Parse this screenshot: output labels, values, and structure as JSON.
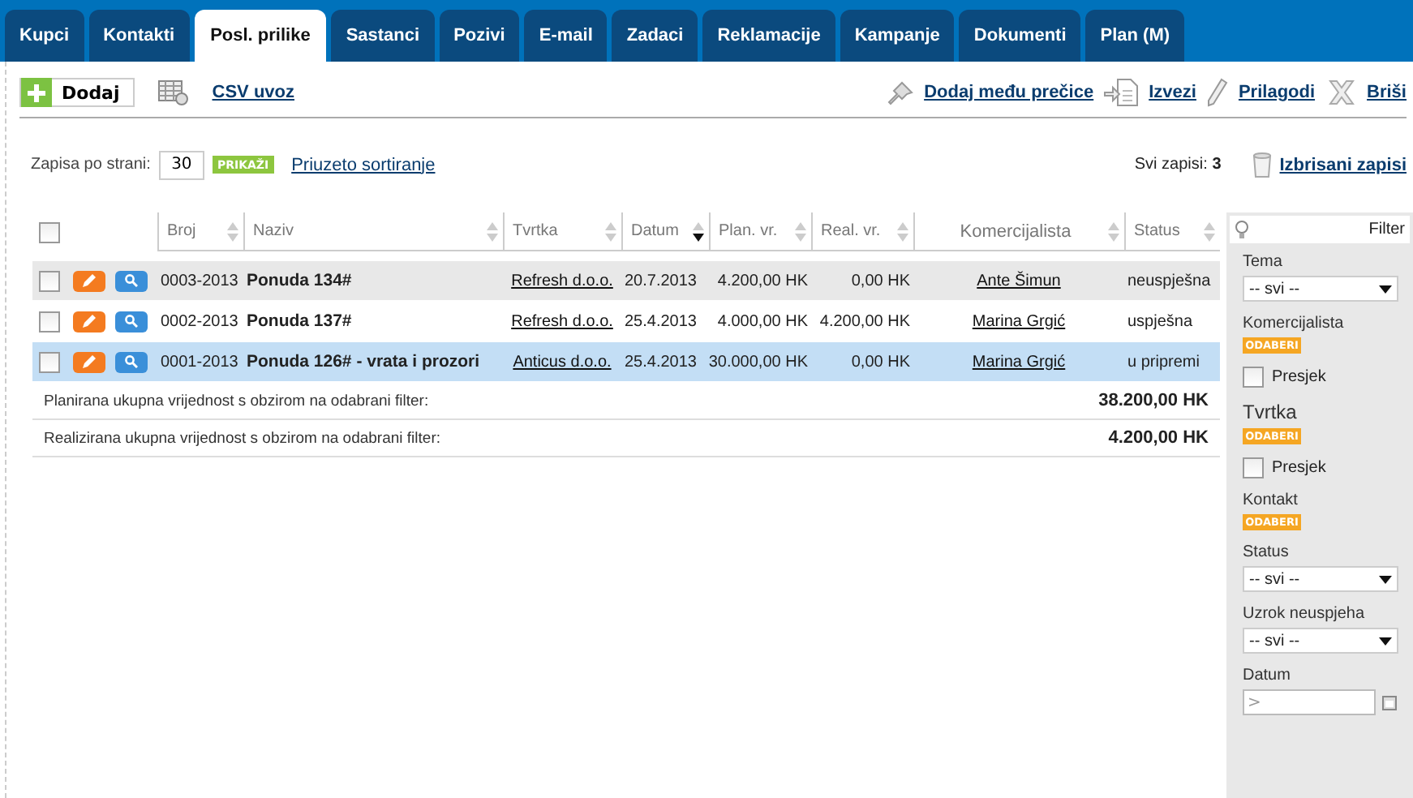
{
  "tabs": [
    {
      "label": "Kupci",
      "selected": false
    },
    {
      "label": "Kontakti",
      "selected": false
    },
    {
      "label": "Posl. prilike",
      "selected": true
    },
    {
      "label": "Sastanci",
      "selected": false
    },
    {
      "label": "Pozivi",
      "selected": false
    },
    {
      "label": "E-mail",
      "selected": false
    },
    {
      "label": "Zadaci",
      "selected": false
    },
    {
      "label": "Reklamacije",
      "selected": false
    },
    {
      "label": "Kampanje",
      "selected": false
    },
    {
      "label": "Dokumenti",
      "selected": false
    },
    {
      "label": "Plan (M)",
      "selected": false
    }
  ],
  "toolbar": {
    "add_button": "Dodaj",
    "csv_link": "CSV uvoz",
    "actions": [
      {
        "kind": "pin",
        "label": "Dodaj među prečice"
      },
      {
        "kind": "export",
        "label": "Izvezi"
      },
      {
        "kind": "pencil",
        "label": "Prilagodi"
      },
      {
        "kind": "cross",
        "label": "Briši"
      }
    ]
  },
  "paging": {
    "label": "Zapisa po strani:",
    "value": "30",
    "show_button": "PRIKAŽI",
    "sort_link": "Priuzeto sortiranje",
    "total_label": "Svi zapisi:",
    "total_count": "3",
    "deleted_link": "Izbrisani zapisi"
  },
  "table": {
    "select_all_checked": false,
    "columns": [
      {
        "label": "Broj",
        "sorted": false
      },
      {
        "label": "Naziv",
        "sorted": false
      },
      {
        "label": "Tvrtka",
        "sorted": false
      },
      {
        "label": "Datum",
        "sorted": true
      },
      {
        "label": "Plan. vr.",
        "sorted": false
      },
      {
        "label": "Real. vr.",
        "sorted": false
      },
      {
        "label": "Komercijalista",
        "sorted": false
      },
      {
        "label": "Status",
        "sorted": false
      }
    ],
    "rows": [
      {
        "checked": false,
        "selected": false,
        "hovered": true,
        "broj": "0003-2013",
        "naziv": "Ponuda 134#",
        "tvrtka": "Refresh d.o.o.",
        "datum": "20.7.2013",
        "plan": "4.200,00 HK",
        "real": "0,00 HK",
        "komercijalista": "Ante Šimun",
        "status": "neuspješna"
      },
      {
        "checked": false,
        "selected": false,
        "hovered": false,
        "broj": "0002-2013",
        "naziv": "Ponuda 137#",
        "tvrtka": "Refresh d.o.o.",
        "datum": "25.4.2013",
        "plan": "4.000,00 HK",
        "real": "4.200,00 HK",
        "komercijalista": "Marina Grgić",
        "status": "uspješna"
      },
      {
        "checked": false,
        "selected": true,
        "hovered": false,
        "broj": "0001-2013",
        "naziv": "Ponuda 126# - vrata i prozori",
        "tvrtka": "Anticus d.o.o.",
        "datum": "25.4.2013",
        "plan": "30.000,00 HK",
        "real": "0,00 HK",
        "komercijalista": "Marina Grgić",
        "status": "u pripremi"
      }
    ],
    "totals": [
      {
        "label": "Planirana ukupna vrijednost s obzirom na odabrani filter:",
        "value": "38.200,00 HK"
      },
      {
        "label": "Realizirana ukupna vrijednost s obzirom na odabrani filter:",
        "value": "4.200,00 HK"
      }
    ]
  },
  "filter": {
    "title": "Filter",
    "sections": [
      {
        "kind": "select",
        "label": "Tema",
        "value": "-- svi --"
      },
      {
        "kind": "picker",
        "label": "Komercijalista",
        "button": "ODABERI"
      },
      {
        "kind": "checkbox",
        "label": "Presjek",
        "checked": false
      },
      {
        "kind": "picker",
        "label": "Tvrtka",
        "button": "ODABERI",
        "large": true
      },
      {
        "kind": "checkbox",
        "label": "Presjek",
        "checked": false
      },
      {
        "kind": "picker",
        "label": "Kontakt",
        "button": "ODABERI"
      },
      {
        "kind": "select",
        "label": "Status",
        "value": "-- svi --"
      },
      {
        "kind": "select",
        "label": "Uzrok neuspjeha",
        "value": "-- svi --"
      },
      {
        "kind": "date",
        "label": "Datum",
        "placeholder": ">"
      }
    ]
  }
}
